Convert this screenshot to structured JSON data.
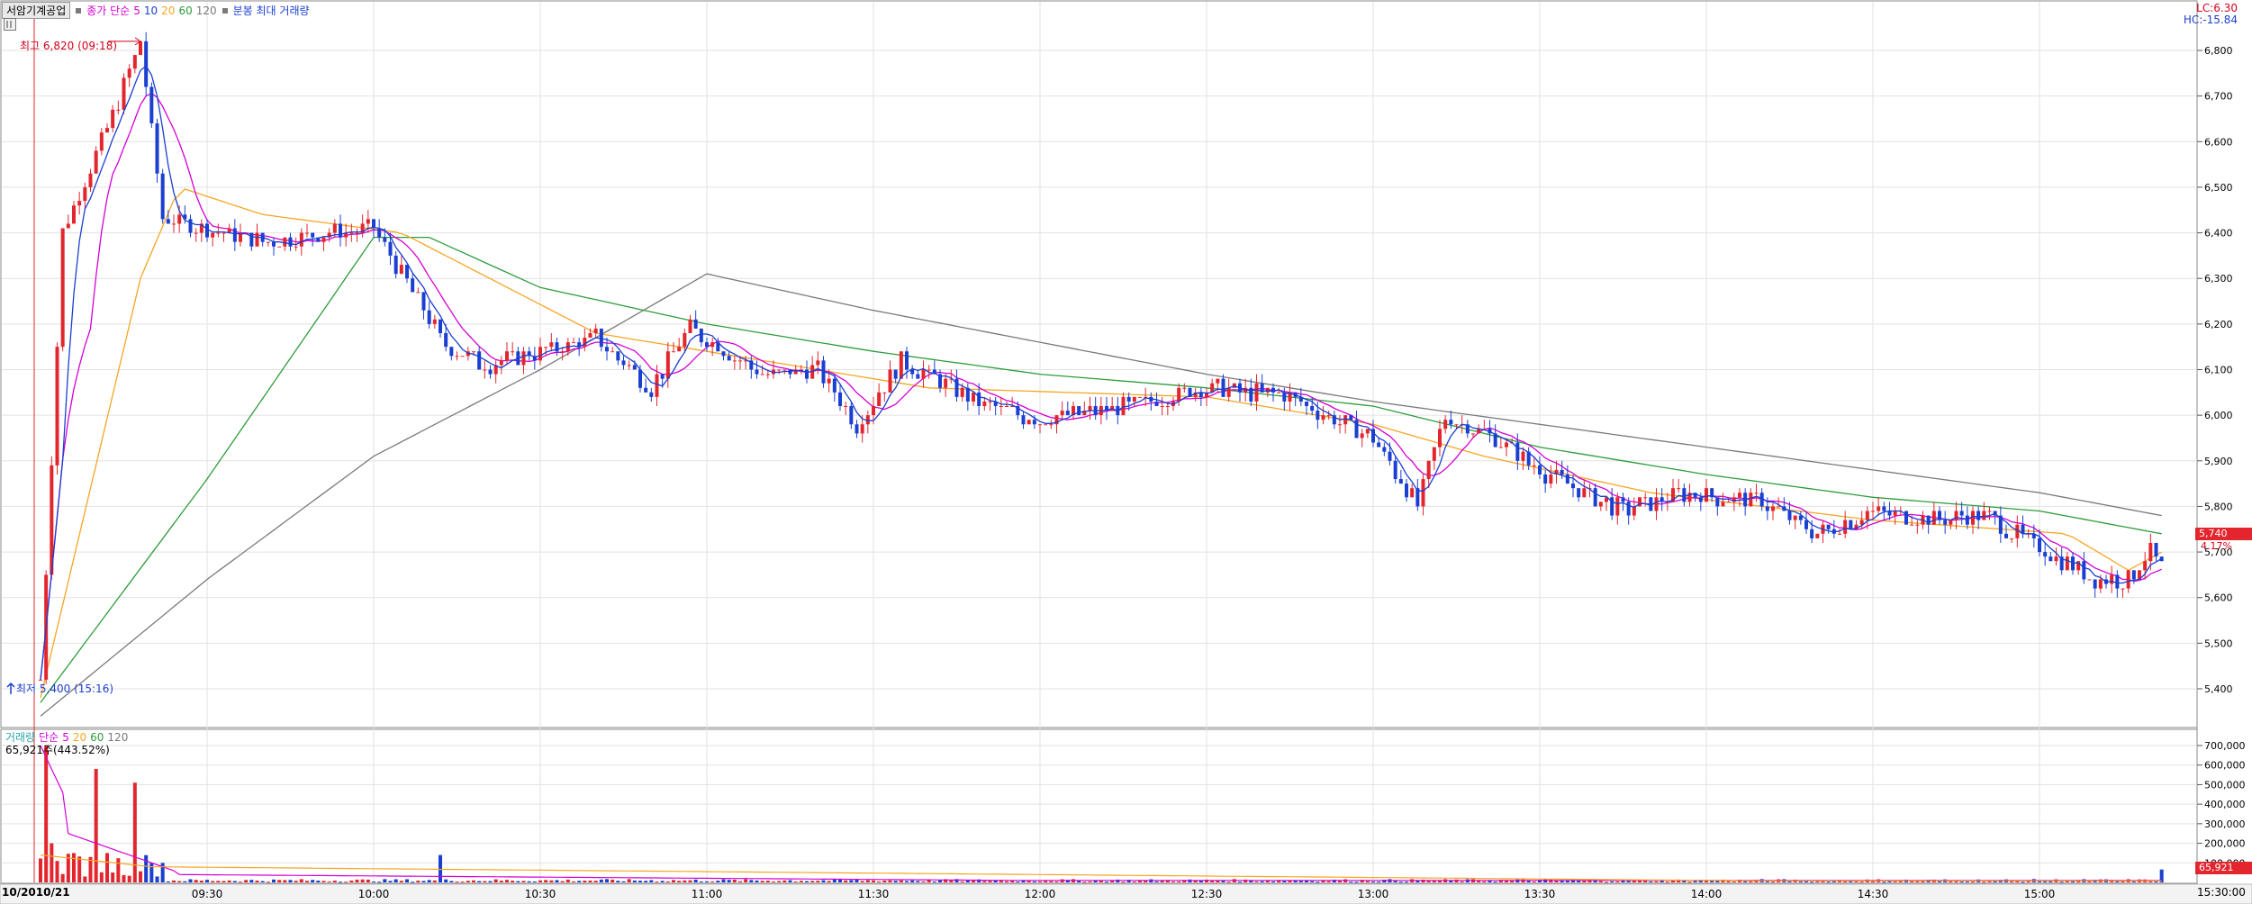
{
  "legend": {
    "stock_name": "서암기계공업",
    "price_series": "종가 단순",
    "ma": [
      {
        "label": "5",
        "color": "#1a3fd1"
      },
      {
        "label": "10",
        "color": "#d400d4"
      },
      {
        "label": "20",
        "color": "#f5a623"
      },
      {
        "label": "60",
        "color": "#2e9c3c"
      },
      {
        "label": "120",
        "color": "#7a7a7a"
      }
    ],
    "extra": "분봉 최대 거래량"
  },
  "lc_label": "LC:6.30",
  "hc_label": "HC:-15.84",
  "high_annotation": "최고 6,820 (09:18)",
  "low_annotation": "최저 5,400 (15:16)",
  "last_price": "5,740",
  "last_pct": "4.17%",
  "volume_legend": {
    "name": "거래량",
    "series": "단순",
    "ma": [
      {
        "label": "5",
        "color": "#d400d4"
      },
      {
        "label": "20",
        "color": "#f5a623"
      },
      {
        "label": "60",
        "color": "#2e9c3c"
      },
      {
        "label": "120",
        "color": "#7a7a7a"
      }
    ]
  },
  "volume_info": "65,921주(443.52%)",
  "last_volume": "65,921",
  "date_label": "10/20",
  "date_label2": "10/21",
  "last_time": "15:30:00",
  "colors": {
    "up": "#e3262e",
    "down": "#1a3fd1",
    "grid": "#e2e2e2",
    "border": "#8a8a8a"
  },
  "chart_data": {
    "type": "candlestick",
    "title": "서암기계공업",
    "price_axis": {
      "ticks": [
        "6,800",
        "6,700",
        "6,600",
        "6,500",
        "6,400",
        "6,300",
        "6,200",
        "6,100",
        "6,000",
        "5,900",
        "5,800",
        "5,700",
        "5,600",
        "5,500",
        "5,400"
      ],
      "ylim": [
        5340,
        6900
      ]
    },
    "volume_axis": {
      "ticks": [
        "700,000",
        "600,000",
        "500,000",
        "400,000",
        "300,000",
        "200,000",
        "100,000"
      ],
      "ylim": [
        0,
        720000
      ]
    },
    "time_ticks": [
      "09:30",
      "10:00",
      "10:30",
      "11:00",
      "11:30",
      "12:00",
      "12:30",
      "13:00",
      "13:30",
      "14:00",
      "14:30",
      "15:00"
    ],
    "high": {
      "value": 6820,
      "time": "09:18"
    },
    "low": {
      "value": 5400,
      "time": "15:16"
    },
    "ohlc_keypoints": [
      {
        "t": "09:00",
        "price": 5420
      },
      {
        "t": "09:04",
        "price": 6400
      },
      {
        "t": "09:15",
        "price": 6720
      },
      {
        "t": "09:18",
        "price": 6820
      },
      {
        "t": "09:22",
        "price": 6430
      },
      {
        "t": "09:40",
        "price": 6380
      },
      {
        "t": "10:00",
        "price": 6410
      },
      {
        "t": "10:13",
        "price": 6150
      },
      {
        "t": "10:20",
        "price": 6110
      },
      {
        "t": "10:40",
        "price": 6170
      },
      {
        "t": "10:50",
        "price": 6060
      },
      {
        "t": "10:57",
        "price": 6190
      },
      {
        "t": "11:10",
        "price": 6090
      },
      {
        "t": "11:20",
        "price": 6100
      },
      {
        "t": "11:27",
        "price": 5980
      },
      {
        "t": "11:35",
        "price": 6120
      },
      {
        "t": "11:50",
        "price": 6020
      },
      {
        "t": "12:00",
        "price": 5990
      },
      {
        "t": "12:15",
        "price": 6020
      },
      {
        "t": "12:30",
        "price": 6060
      },
      {
        "t": "12:45",
        "price": 6040
      },
      {
        "t": "13:00",
        "price": 5950
      },
      {
        "t": "13:08",
        "price": 5800
      },
      {
        "t": "13:13",
        "price": 6000
      },
      {
        "t": "13:20",
        "price": 5960
      },
      {
        "t": "13:30",
        "price": 5880
      },
      {
        "t": "13:45",
        "price": 5790
      },
      {
        "t": "13:55",
        "price": 5830
      },
      {
        "t": "14:10",
        "price": 5810
      },
      {
        "t": "14:20",
        "price": 5740
      },
      {
        "t": "14:30",
        "price": 5790
      },
      {
        "t": "14:40",
        "price": 5770
      },
      {
        "t": "14:50",
        "price": 5780
      },
      {
        "t": "15:00",
        "price": 5710
      },
      {
        "t": "15:10",
        "price": 5640
      },
      {
        "t": "15:16",
        "price": 5640
      },
      {
        "t": "15:20",
        "price": 5700
      },
      {
        "t": "15:22",
        "price": 5670
      }
    ],
    "ma20_keypoints": [
      {
        "t": "09:00",
        "price": 5380
      },
      {
        "t": "09:18",
        "price": 6300
      },
      {
        "t": "09:25",
        "price": 6500
      },
      {
        "t": "09:40",
        "price": 6440
      },
      {
        "t": "10:05",
        "price": 6400
      },
      {
        "t": "10:40",
        "price": 6180
      },
      {
        "t": "11:10",
        "price": 6120
      },
      {
        "t": "11:40",
        "price": 6060
      },
      {
        "t": "12:30",
        "price": 6040
      },
      {
        "t": "13:00",
        "price": 5980
      },
      {
        "t": "13:20",
        "price": 5910
      },
      {
        "t": "13:50",
        "price": 5830
      },
      {
        "t": "14:30",
        "price": 5770
      },
      {
        "t": "15:05",
        "price": 5740
      },
      {
        "t": "15:16",
        "price": 5660
      },
      {
        "t": "15:22",
        "price": 5700
      }
    ],
    "ma60_keypoints": [
      {
        "t": "09:00",
        "price": 5370
      },
      {
        "t": "09:30",
        "price": 5860
      },
      {
        "t": "10:00",
        "price": 6390
      },
      {
        "t": "10:10",
        "price": 6390
      },
      {
        "t": "10:30",
        "price": 6280
      },
      {
        "t": "11:00",
        "price": 6200
      },
      {
        "t": "11:30",
        "price": 6140
      },
      {
        "t": "12:00",
        "price": 6090
      },
      {
        "t": "12:30",
        "price": 6060
      },
      {
        "t": "13:00",
        "price": 6020
      },
      {
        "t": "13:30",
        "price": 5930
      },
      {
        "t": "14:00",
        "price": 5870
      },
      {
        "t": "14:30",
        "price": 5820
      },
      {
        "t": "15:00",
        "price": 5790
      },
      {
        "t": "15:22",
        "price": 5740
      }
    ],
    "ma120_keypoints": [
      {
        "t": "09:00",
        "price": 5340
      },
      {
        "t": "09:30",
        "price": 5640
      },
      {
        "t": "10:00",
        "price": 5910
      },
      {
        "t": "10:30",
        "price": 6100
      },
      {
        "t": "11:00",
        "price": 6310
      },
      {
        "t": "11:30",
        "price": 6230
      },
      {
        "t": "12:00",
        "price": 6160
      },
      {
        "t": "12:30",
        "price": 6090
      },
      {
        "t": "13:00",
        "price": 6030
      },
      {
        "t": "13:30",
        "price": 5980
      },
      {
        "t": "14:00",
        "price": 5930
      },
      {
        "t": "14:30",
        "price": 5880
      },
      {
        "t": "15:00",
        "price": 5830
      },
      {
        "t": "15:22",
        "price": 5780
      }
    ],
    "volume_keypoints": [
      {
        "t": "09:01",
        "volume": 700000
      },
      {
        "t": "09:02",
        "volume": 200000
      },
      {
        "t": "09:06",
        "volume": 150000
      },
      {
        "t": "09:10",
        "volume": 580000
      },
      {
        "t": "09:12",
        "volume": 150000
      },
      {
        "t": "09:17",
        "volume": 510000
      },
      {
        "t": "09:20",
        "volume": 100000
      },
      {
        "t": "10:12",
        "volume": 140000
      },
      {
        "t": "15:22",
        "volume": 65921
      }
    ]
  }
}
